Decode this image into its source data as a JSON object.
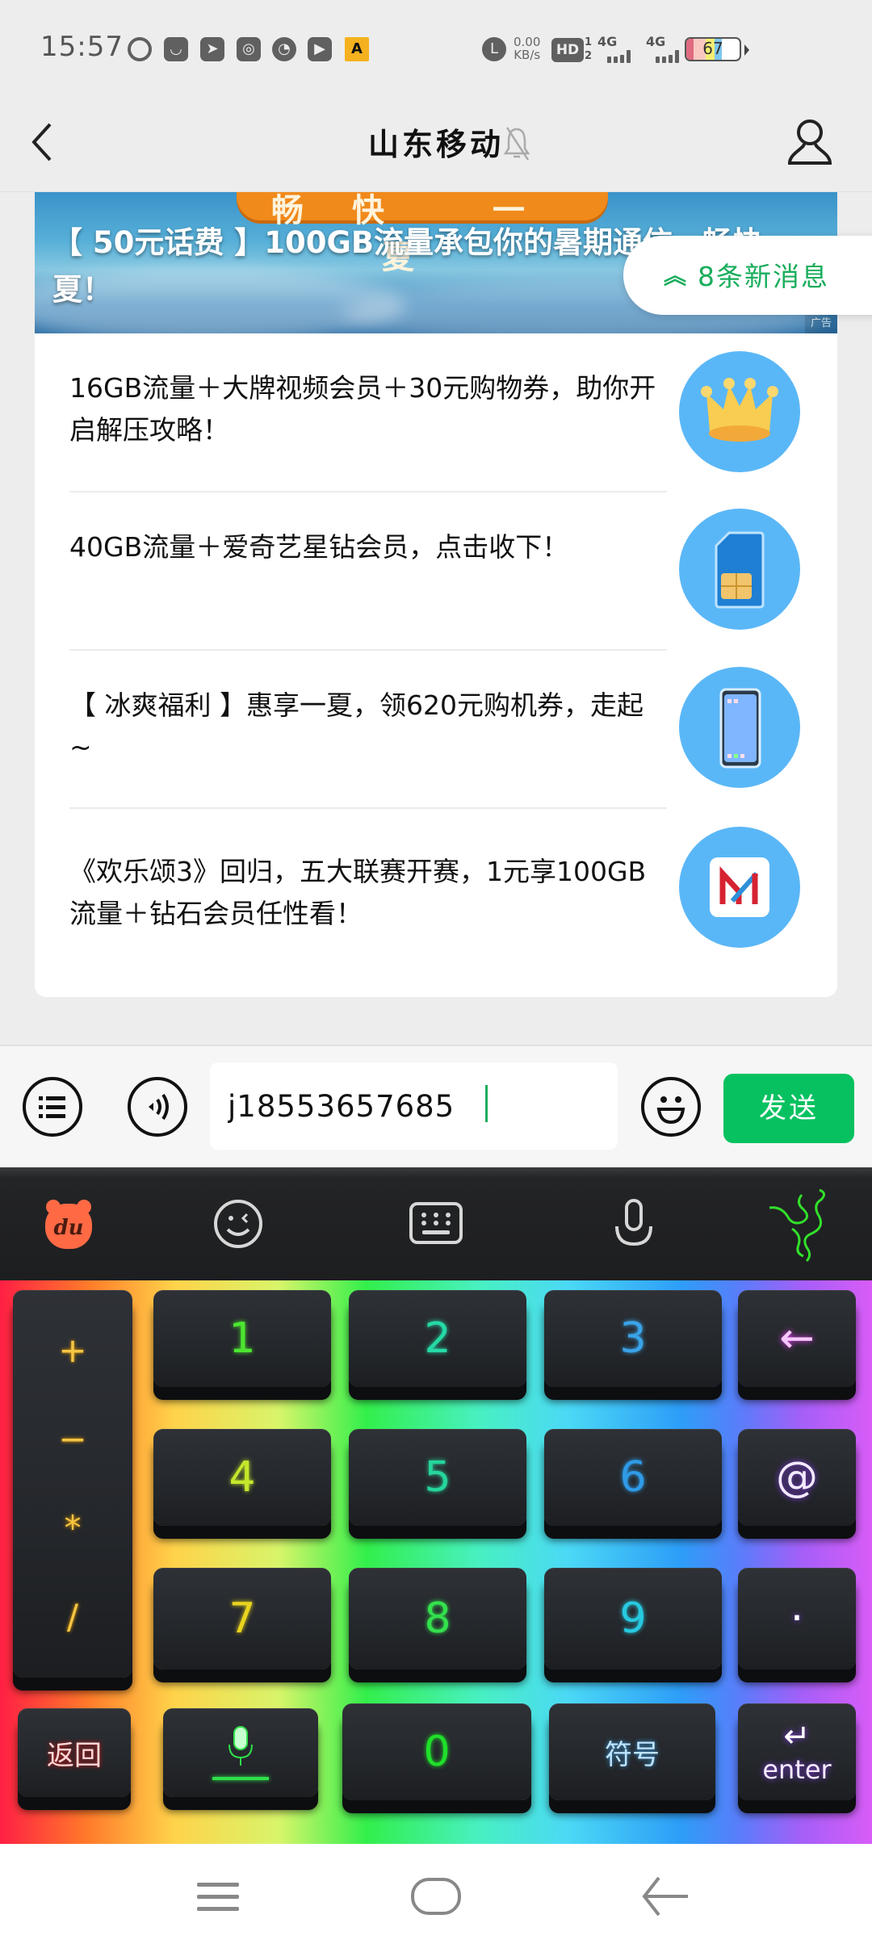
{
  "status_bar": {
    "time": "15:57",
    "notification_icons": [
      "ghost-app-icon",
      "shopping-bag-icon",
      "paper-plane-icon",
      "uc-browser-icon",
      "speedometer-icon",
      "play-icon",
      "app-logo-icon"
    ],
    "net_speed_value": "0.00",
    "net_speed_unit": "KB/s",
    "hd_label": "HD",
    "hd_sub": "1\n2",
    "signal1_label": "4G",
    "signal2_label": "4G",
    "battery_level": 67,
    "battery_text": "67"
  },
  "header": {
    "title": "山东移动",
    "muted": true
  },
  "banner": {
    "image_text": "畅快 一夏",
    "title": "【 50元话费 】100GB流量承包你的暑期通信，畅快一夏！",
    "ad_label": "广告"
  },
  "new_messages": {
    "arrow": "︽",
    "label": "8条新消息"
  },
  "items": [
    {
      "text": "16GB流量＋大牌视频会员＋30元购物券，助你开启解压攻略！",
      "thumb": "crown-icon"
    },
    {
      "text": "40GB流量＋爱奇艺星钻会员，点击收下！",
      "thumb": "sim-card-icon"
    },
    {
      "text": "【 冰爽福利 】惠享一夏，领620元购机券，走起~",
      "thumb": "smartphone-icon"
    },
    {
      "text": "《欢乐颂3》回归，五大联赛开赛，1元享100GB流量＋钻石会员任性看！",
      "thumb": "migu-logo-icon"
    }
  ],
  "input_bar": {
    "menu_icon": "list-menu-icon",
    "voice_icon": "voice-icon",
    "input_value": "j18553657685",
    "emoji_icon": "emoji-icon",
    "send_label": "发送",
    "accent": "#07c160"
  },
  "keyboard": {
    "toolbar": [
      "du-bear-logo",
      "emoji-wink-icon",
      "keyboard-icon",
      "microphone-icon",
      "razer-logo"
    ],
    "ops": [
      "+",
      "−",
      "*",
      "/"
    ],
    "digits": [
      "1",
      "2",
      "3",
      "4",
      "5",
      "6",
      "7",
      "8",
      "9"
    ],
    "backspace": "←",
    "at": "@",
    "dot": "·",
    "back_label": "返回",
    "zero": "0",
    "symbols_label": "符号",
    "enter_label": "enter",
    "enter_glyph": "↵"
  },
  "nav_bar": [
    "menu-icon",
    "home-icon",
    "back-icon"
  ]
}
